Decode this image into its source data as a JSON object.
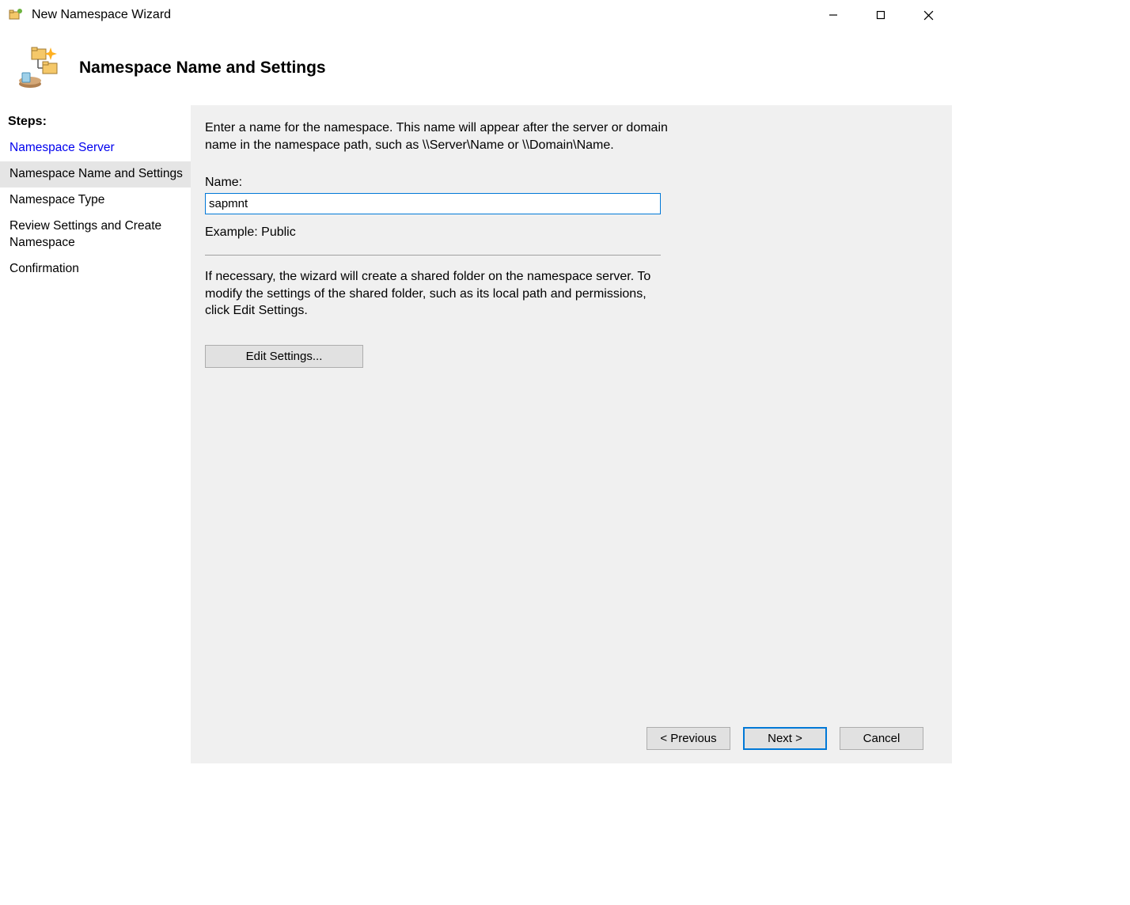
{
  "titlebar": {
    "title": "New Namespace Wizard"
  },
  "header": {
    "title": "Namespace Name and Settings"
  },
  "sidebar": {
    "heading": "Steps:",
    "steps": [
      {
        "label": "Namespace Server",
        "state": "completed"
      },
      {
        "label": "Namespace Name and Settings",
        "state": "active"
      },
      {
        "label": "Namespace Type",
        "state": "pending"
      },
      {
        "label": "Review Settings and Create Namespace",
        "state": "pending"
      },
      {
        "label": "Confirmation",
        "state": "pending"
      }
    ]
  },
  "main": {
    "instruction": "Enter a name for the namespace. This name will appear after the server or domain name in the namespace path, such as \\\\Server\\Name or \\\\Domain\\Name.",
    "name_label": "Name:",
    "name_value": "sapmnt",
    "example_label": "Example: Public",
    "instruction2": "If necessary, the wizard will create a shared folder on the namespace server. To modify the settings of the shared folder, such as its local path and permissions, click Edit Settings.",
    "edit_settings_label": "Edit Settings..."
  },
  "footer": {
    "previous_label": "< Previous",
    "next_label": "Next >",
    "cancel_label": "Cancel"
  }
}
